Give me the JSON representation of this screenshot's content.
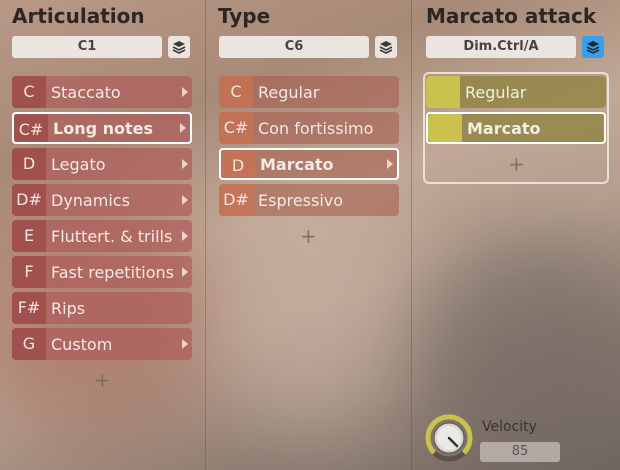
{
  "columns": {
    "articulation": {
      "title": "Articulation",
      "selector": "C1",
      "items": [
        {
          "key": "C",
          "label": "Staccato",
          "arrow": true
        },
        {
          "key": "C#",
          "label": "Long notes",
          "arrow": true,
          "selected": true
        },
        {
          "key": "D",
          "label": "Legato",
          "arrow": true
        },
        {
          "key": "D#",
          "label": "Dynamics",
          "arrow": true
        },
        {
          "key": "E",
          "label": "Fluttert. & trills",
          "arrow": true
        },
        {
          "key": "F",
          "label": "Fast repetitions",
          "arrow": true
        },
        {
          "key": "F#",
          "label": "Rips",
          "arrow": false
        },
        {
          "key": "G",
          "label": "Custom",
          "arrow": true
        }
      ],
      "add_label": "+"
    },
    "type": {
      "title": "Type",
      "selector": "C6",
      "items": [
        {
          "key": "C",
          "label": "Regular",
          "arrow": false
        },
        {
          "key": "C#",
          "label": "Con fortissimo",
          "arrow": false
        },
        {
          "key": "D",
          "label": "Marcato",
          "arrow": true,
          "selected": true
        },
        {
          "key": "D#",
          "label": "Espressivo",
          "arrow": false
        }
      ],
      "add_label": "+"
    },
    "marcato_attack": {
      "title": "Marcato attack",
      "selector": "Dim.Ctrl/A",
      "items": [
        {
          "key": "",
          "label": "Regular"
        },
        {
          "key": "",
          "label": "Marcato",
          "selected": true
        }
      ],
      "add_label": "+"
    }
  },
  "velocity": {
    "label": "Velocity",
    "value": "85"
  },
  "colors": {
    "accent": "#3b9ee8",
    "knob_ring": "#c9c24e"
  }
}
